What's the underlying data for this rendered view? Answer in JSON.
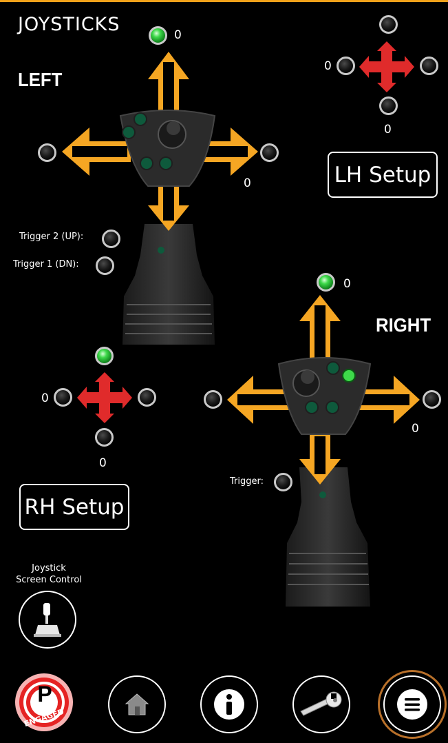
{
  "header": {
    "title": "JOYSTICKS"
  },
  "left": {
    "label": "LEFT",
    "up_count": "0",
    "right_count": "0",
    "trigger2_label": "Trigger 2 (UP):",
    "trigger1_label": "Trigger 1 (DN):",
    "setup_label": "LH Setup",
    "pad": {
      "left_count": "0",
      "down_count": "0"
    }
  },
  "right": {
    "label": "RIGHT",
    "up_count": "0",
    "right_count": "0",
    "trigger_label": "Trigger:",
    "setup_label": "RH Setup",
    "pad": {
      "left_count": "0",
      "down_count": "0"
    }
  },
  "screen_control": {
    "label_line1": "Joystick",
    "label_line2": "Screen Control"
  },
  "bottom_nav": {
    "parking_letter": "P",
    "parking_status": "ENGAGED"
  },
  "colors": {
    "arrow": "#f5a623",
    "pad": "#e02b2b",
    "led_on": "#3ed94a",
    "accent": "#f0a11a"
  }
}
